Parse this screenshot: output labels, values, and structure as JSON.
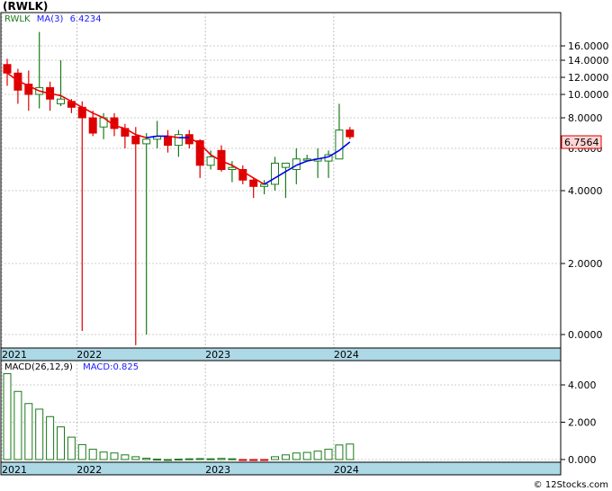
{
  "header": {
    "title": "(RWLK)",
    "symbol": "RWLK",
    "ma_label": "MA(3)",
    "ma_value": "6.4234",
    "last_price": "6.7564"
  },
  "macd_legend": {
    "label": "MACD(26,12,9)",
    "value_label": "MACD:0.825"
  },
  "footer": {
    "watermark": "© 12Stocks.com"
  },
  "colors": {
    "up": "#1a7a1a",
    "down": "#dd0000",
    "ma_down": "#ee0000",
    "ma_up": "#0000ee",
    "axis_band": "#add8e6",
    "grid": "#999999",
    "price_tag_bg": "#ffd6d6"
  },
  "chart_data": [
    {
      "type": "candlestick",
      "name": "price",
      "ylim": [
        0,
        20
      ],
      "y_ticks": [
        "16.0000",
        "14.0000",
        "12.0000",
        "10.0000",
        "8.0000",
        "6.0000",
        "4.0000",
        "2.0000",
        "0.0000"
      ],
      "y_tick_values": [
        16,
        14,
        12,
        10,
        8,
        6,
        4,
        2,
        0
      ],
      "x_ticks": [
        "2021",
        "2022",
        "2023",
        "2024"
      ],
      "x_tick_index": [
        0,
        7,
        19,
        31
      ],
      "grid": true,
      "candles": [
        {
          "o": 13.5,
          "h": 14.2,
          "l": 11.0,
          "c": 12.5
        },
        {
          "o": 12.5,
          "h": 13.0,
          "l": 9.2,
          "c": 10.5
        },
        {
          "o": 11.2,
          "h": 12.8,
          "l": 8.6,
          "c": 10.0
        },
        {
          "o": 10.0,
          "h": 18.0,
          "l": 8.8,
          "c": 10.8
        },
        {
          "o": 10.8,
          "h": 11.5,
          "l": 8.6,
          "c": 9.6
        },
        {
          "o": 9.2,
          "h": 14.0,
          "l": 9.0,
          "c": 9.6
        },
        {
          "o": 9.4,
          "h": 9.6,
          "l": 8.4,
          "c": 8.9
        },
        {
          "o": 8.9,
          "h": 9.4,
          "l": 0.1,
          "c": 8.0
        },
        {
          "o": 8.0,
          "h": 8.6,
          "l": 6.8,
          "c": 7.0
        },
        {
          "o": 7.4,
          "h": 8.4,
          "l": 6.6,
          "c": 8.0
        },
        {
          "o": 8.0,
          "h": 8.4,
          "l": 6.8,
          "c": 7.3
        },
        {
          "o": 7.3,
          "h": 7.6,
          "l": 6.0,
          "c": 6.8
        },
        {
          "o": 6.8,
          "h": 7.4,
          "l": -0.3,
          "c": 6.3
        },
        {
          "o": 6.3,
          "h": 7.0,
          "l": 0.0,
          "c": 6.6
        },
        {
          "o": 6.6,
          "h": 7.8,
          "l": 6.0,
          "c": 6.8
        },
        {
          "o": 6.8,
          "h": 7.2,
          "l": 5.8,
          "c": 6.2
        },
        {
          "o": 6.2,
          "h": 7.2,
          "l": 5.6,
          "c": 6.9
        },
        {
          "o": 6.9,
          "h": 7.2,
          "l": 6.0,
          "c": 6.3
        },
        {
          "o": 6.5,
          "h": 6.6,
          "l": 4.6,
          "c": 5.2
        },
        {
          "o": 5.2,
          "h": 5.9,
          "l": 5.0,
          "c": 5.6
        },
        {
          "o": 5.9,
          "h": 6.2,
          "l": 4.9,
          "c": 5.0
        },
        {
          "o": 5.0,
          "h": 5.4,
          "l": 4.4,
          "c": 5.1
        },
        {
          "o": 5.0,
          "h": 5.2,
          "l": 4.3,
          "c": 4.5
        },
        {
          "o": 4.5,
          "h": 4.6,
          "l": 3.8,
          "c": 4.2
        },
        {
          "o": 4.2,
          "h": 4.5,
          "l": 3.9,
          "c": 4.3
        },
        {
          "o": 4.3,
          "h": 5.6,
          "l": 4.0,
          "c": 5.3
        },
        {
          "o": 5.1,
          "h": 5.3,
          "l": 3.8,
          "c": 5.3
        },
        {
          "o": 5.0,
          "h": 6.0,
          "l": 4.3,
          "c": 5.5
        },
        {
          "o": 5.5,
          "h": 5.7,
          "l": 5.4,
          "c": 5.5
        },
        {
          "o": 5.4,
          "h": 6.0,
          "l": 4.6,
          "c": 5.5
        },
        {
          "o": 5.4,
          "h": 5.9,
          "l": 4.6,
          "c": 5.7
        },
        {
          "o": 5.5,
          "h": 9.2,
          "l": 5.5,
          "c": 7.2
        },
        {
          "o": 7.2,
          "h": 7.4,
          "l": 6.6,
          "c": 6.76
        }
      ],
      "ma": [
        12.5,
        11.6,
        11.0,
        10.4,
        10.1,
        9.9,
        9.4,
        8.9,
        8.4,
        8.0,
        7.5,
        7.3,
        6.9,
        6.7,
        6.8,
        6.8,
        6.7,
        6.7,
        6.3,
        5.7,
        5.4,
        5.2,
        4.9,
        4.6,
        4.3,
        4.6,
        4.9,
        5.2,
        5.4,
        5.5,
        5.6,
        5.9,
        6.42
      ]
    },
    {
      "type": "bar",
      "name": "MACD(26,12,9)",
      "ylim": [
        -0.2,
        5.0
      ],
      "y_ticks": [
        "4.000",
        "2.000",
        "0.000"
      ],
      "y_tick_values": [
        4,
        2,
        0
      ],
      "x_ticks": [
        "2021",
        "2022",
        "2023",
        "2024"
      ],
      "x_tick_index": [
        0,
        7,
        19,
        31
      ],
      "values": [
        4.6,
        3.65,
        3.0,
        2.7,
        2.3,
        1.75,
        1.2,
        0.8,
        0.55,
        0.4,
        0.35,
        0.25,
        0.15,
        0.07,
        0.02,
        0.0,
        0.02,
        0.04,
        0.05,
        0.04,
        0.06,
        0.04,
        -0.03,
        -0.05,
        -0.04,
        0.15,
        0.25,
        0.35,
        0.38,
        0.45,
        0.55,
        0.78,
        0.83
      ]
    }
  ]
}
